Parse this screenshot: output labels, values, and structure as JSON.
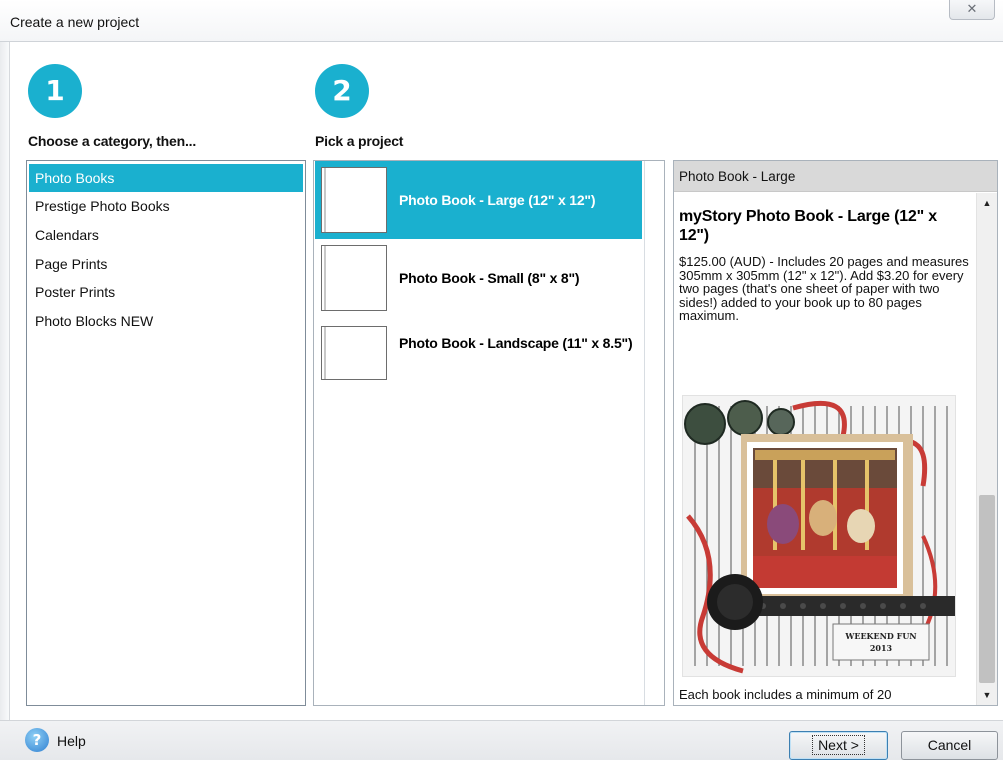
{
  "window": {
    "title": "Create a new project",
    "close_glyph": "✕"
  },
  "steps": [
    {
      "number": "1",
      "label": "Choose a category, then..."
    },
    {
      "number": "2",
      "label": "Pick a project"
    }
  ],
  "categories": [
    {
      "label": "Photo Books",
      "selected": true
    },
    {
      "label": "Prestige Photo Books",
      "selected": false
    },
    {
      "label": "Calendars",
      "selected": false
    },
    {
      "label": "Page Prints",
      "selected": false
    },
    {
      "label": "Poster Prints",
      "selected": false
    },
    {
      "label": "Photo Blocks NEW",
      "selected": false
    }
  ],
  "projects": [
    {
      "label": "Photo Book - Large (12\" x 12\")",
      "selected": true
    },
    {
      "label": "Photo Book - Small (8\" x 8\")",
      "selected": false
    },
    {
      "label": "Photo Book - Landscape (11\" x 8.5\")",
      "selected": false
    }
  ],
  "detail": {
    "header": "Photo Book - Large",
    "title": "myStory Photo Book - Large (12\" x 12\")",
    "description": "$125.00 (AUD) - Includes 20 pages and measures 305mm x 305mm (12\" x 12\"). Add $3.20 for every two pages (that's one sheet of paper with two sides!) added to your book up to 80 pages maximum.",
    "image_caption": "WEEKEND FUN 2013",
    "footer_text": "Each book includes a minimum of 20"
  },
  "footer": {
    "help_label": "Help",
    "next_label": "Next >",
    "cancel_label": "Cancel"
  },
  "colors": {
    "accent": "#1ab0cf",
    "selection_text": "#ffffff"
  }
}
